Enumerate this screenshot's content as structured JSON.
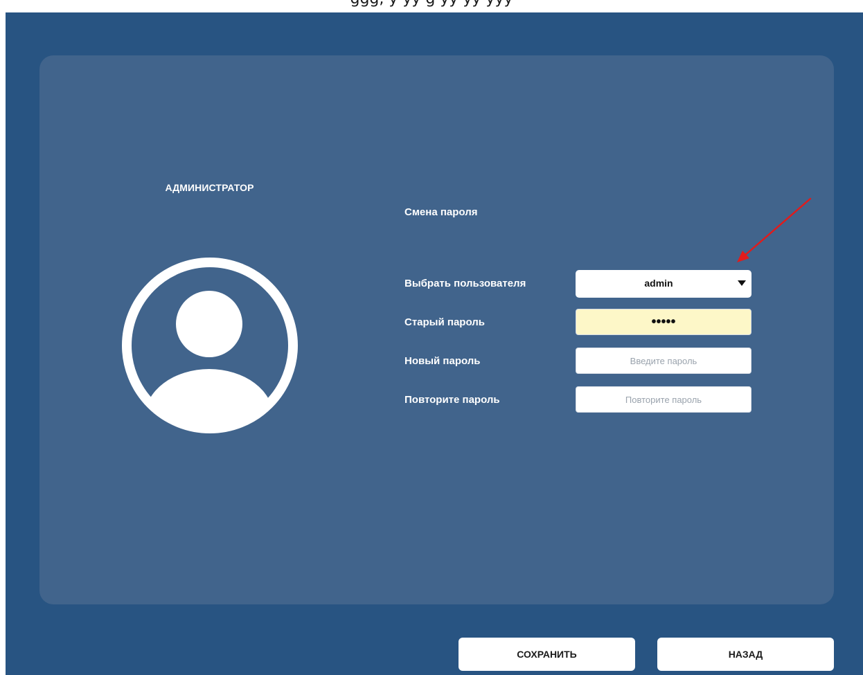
{
  "user_card": {
    "role_title": "АДМИНИСТРАТОР",
    "avatar_icon": "user-avatar-icon"
  },
  "form": {
    "section_title": "Смена пароля",
    "select_user": {
      "label": "Выбрать пользователя",
      "value": "admin",
      "icon": "caret-down-icon"
    },
    "old_password": {
      "label": "Старый пароль",
      "value": "•••••"
    },
    "new_password": {
      "label": "Новый пароль",
      "placeholder": "Введите пароль"
    },
    "repeat_password": {
      "label": "Повторите пароль",
      "placeholder": "Повторите пароль"
    }
  },
  "actions": {
    "save_label": "СОХРАНИТЬ",
    "back_label": "НАЗАД"
  },
  "annotation": {
    "icon": "red-arrow-annotation",
    "color": "#e21b1b"
  },
  "colors": {
    "background": "#285482",
    "panel": "#41648c",
    "old_password_fill": "#fdf7c8"
  }
}
